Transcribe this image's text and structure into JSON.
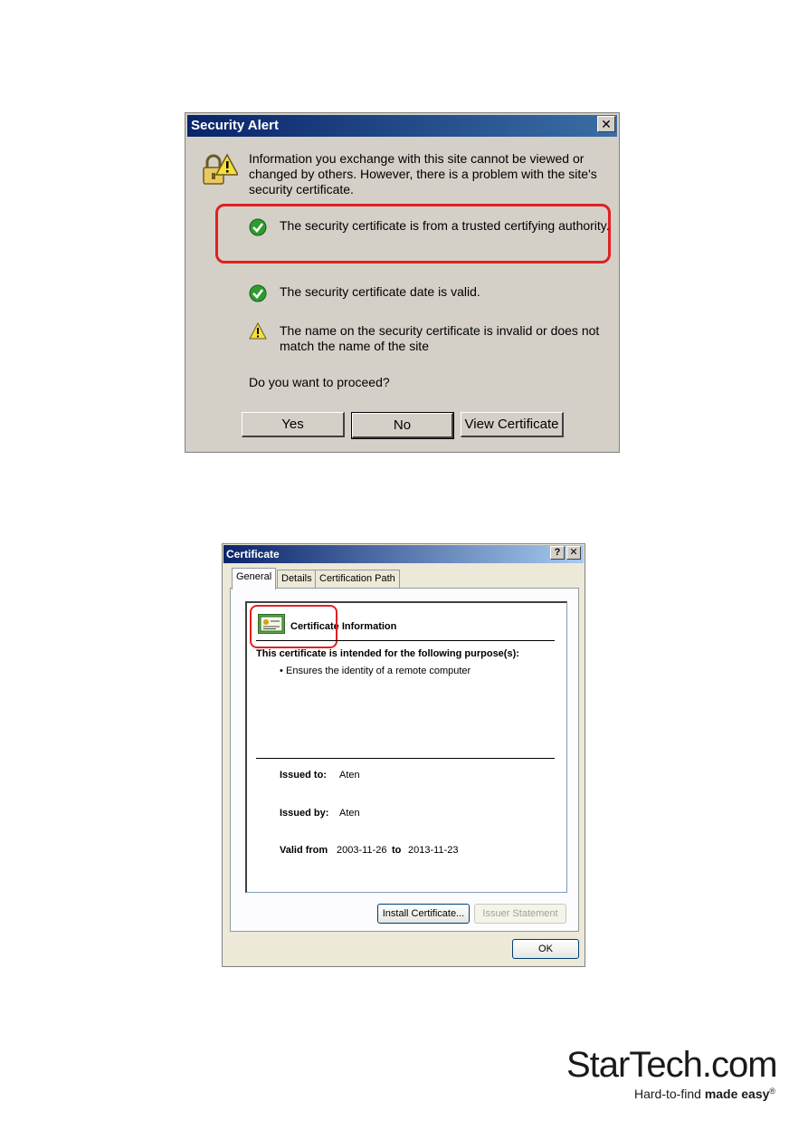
{
  "security_alert": {
    "title": "Security Alert",
    "close_label": "✕",
    "message_line1": "Information you exchange with this site cannot be viewed or",
    "message_line2": "changed by others. However, there is a problem with the site's",
    "message_line3": "security certificate.",
    "checks": [
      {
        "text": "The security certificate is from a trusted certifying authority.",
        "status": "ok"
      },
      {
        "text": "The security certificate date is valid.",
        "status": "ok"
      },
      {
        "text_line1": "The name on the security certificate is invalid or does not",
        "text_line2": "match the name of the site",
        "status": "warning"
      }
    ],
    "question": "Do you want to proceed?",
    "buttons": {
      "yes": "Yes",
      "no": "No",
      "view": "View Certificate"
    }
  },
  "certificate": {
    "title": "Certificate",
    "help_label": "?",
    "close_label": "✕",
    "tabs": [
      "General",
      "Details",
      "Certification Path"
    ],
    "heading": "Certificate Information",
    "purpose_heading": "This certificate is intended for the following purpose(s):",
    "purposes": [
      "Ensures the identity of a remote computer"
    ],
    "issued_to_label": "Issued to:",
    "issued_to": "Aten",
    "issued_by_label": "Issued by:",
    "issued_by": "Aten",
    "valid_from_label": "Valid from",
    "valid_from": "2003-11-26",
    "to_label": "to",
    "valid_to": "2013-11-23",
    "buttons": {
      "install": "Install Certificate...",
      "issuer": "Issuer Statement",
      "ok": "OK"
    }
  },
  "logo": {
    "brand": "StarTech.com",
    "tagline_plain": "Hard-to-find ",
    "tagline_bold": "made easy",
    "registered": "®"
  },
  "colors": {
    "highlight": "#e02020",
    "ok_green": "#2e9b2e",
    "warn_yellow": "#f5e03a"
  }
}
